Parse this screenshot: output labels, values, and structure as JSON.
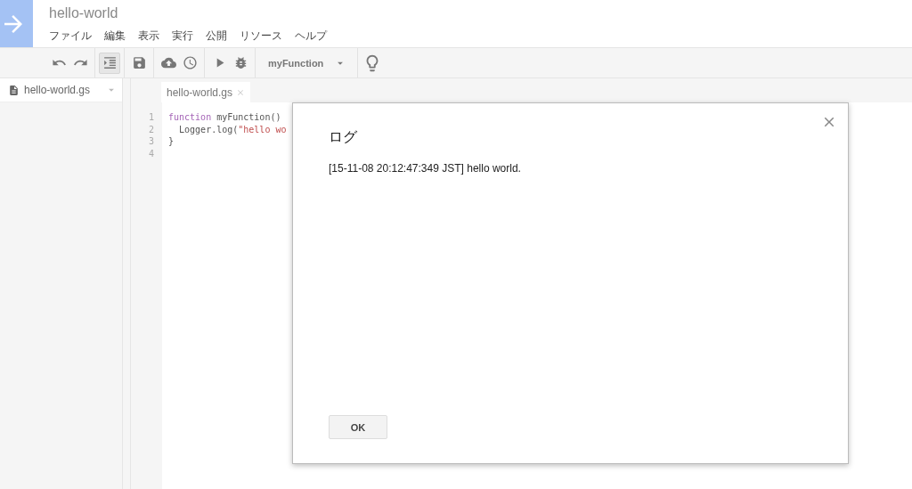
{
  "header": {
    "title": "hello-world",
    "menu": [
      "ファイル",
      "編集",
      "表示",
      "実行",
      "公開",
      "リソース",
      "ヘルプ"
    ]
  },
  "toolbar": {
    "items": [
      {
        "kind": "undo",
        "pressed": false
      },
      {
        "kind": "redo",
        "pressed": false
      },
      {
        "kind": "indent",
        "pressed": true
      },
      {
        "kind": "save",
        "pressed": false
      },
      {
        "kind": "cloud",
        "pressed": false
      },
      {
        "kind": "clock",
        "pressed": false
      },
      {
        "kind": "run",
        "pressed": false
      },
      {
        "kind": "debug",
        "pressed": false
      },
      {
        "kind": "function",
        "value": "myFunction"
      },
      {
        "kind": "bulb",
        "pressed": false
      }
    ]
  },
  "sidebar": {
    "files": [
      {
        "name": "hello-world.gs",
        "selected": true
      }
    ]
  },
  "editor": {
    "tabs": [
      {
        "label": "hello-world.gs",
        "selected": true
      }
    ],
    "lines": [
      {
        "number": "1",
        "segments": [
          {
            "kind": "keyword",
            "text": "function"
          },
          {
            "kind": "plain",
            "text": " myFunction()"
          }
        ]
      },
      {
        "number": "2",
        "segments": [
          {
            "kind": "plain",
            "text": "  Logger.log("
          },
          {
            "kind": "string",
            "text": "\"hello wo"
          }
        ]
      },
      {
        "number": "3",
        "segments": [
          {
            "kind": "plain",
            "text": "}"
          }
        ]
      },
      {
        "number": "4"
      }
    ]
  },
  "dialog": {
    "title": "ログ",
    "message": "[15-11-08 20:12:47:349 JST] hello world.",
    "button": "OK"
  }
}
